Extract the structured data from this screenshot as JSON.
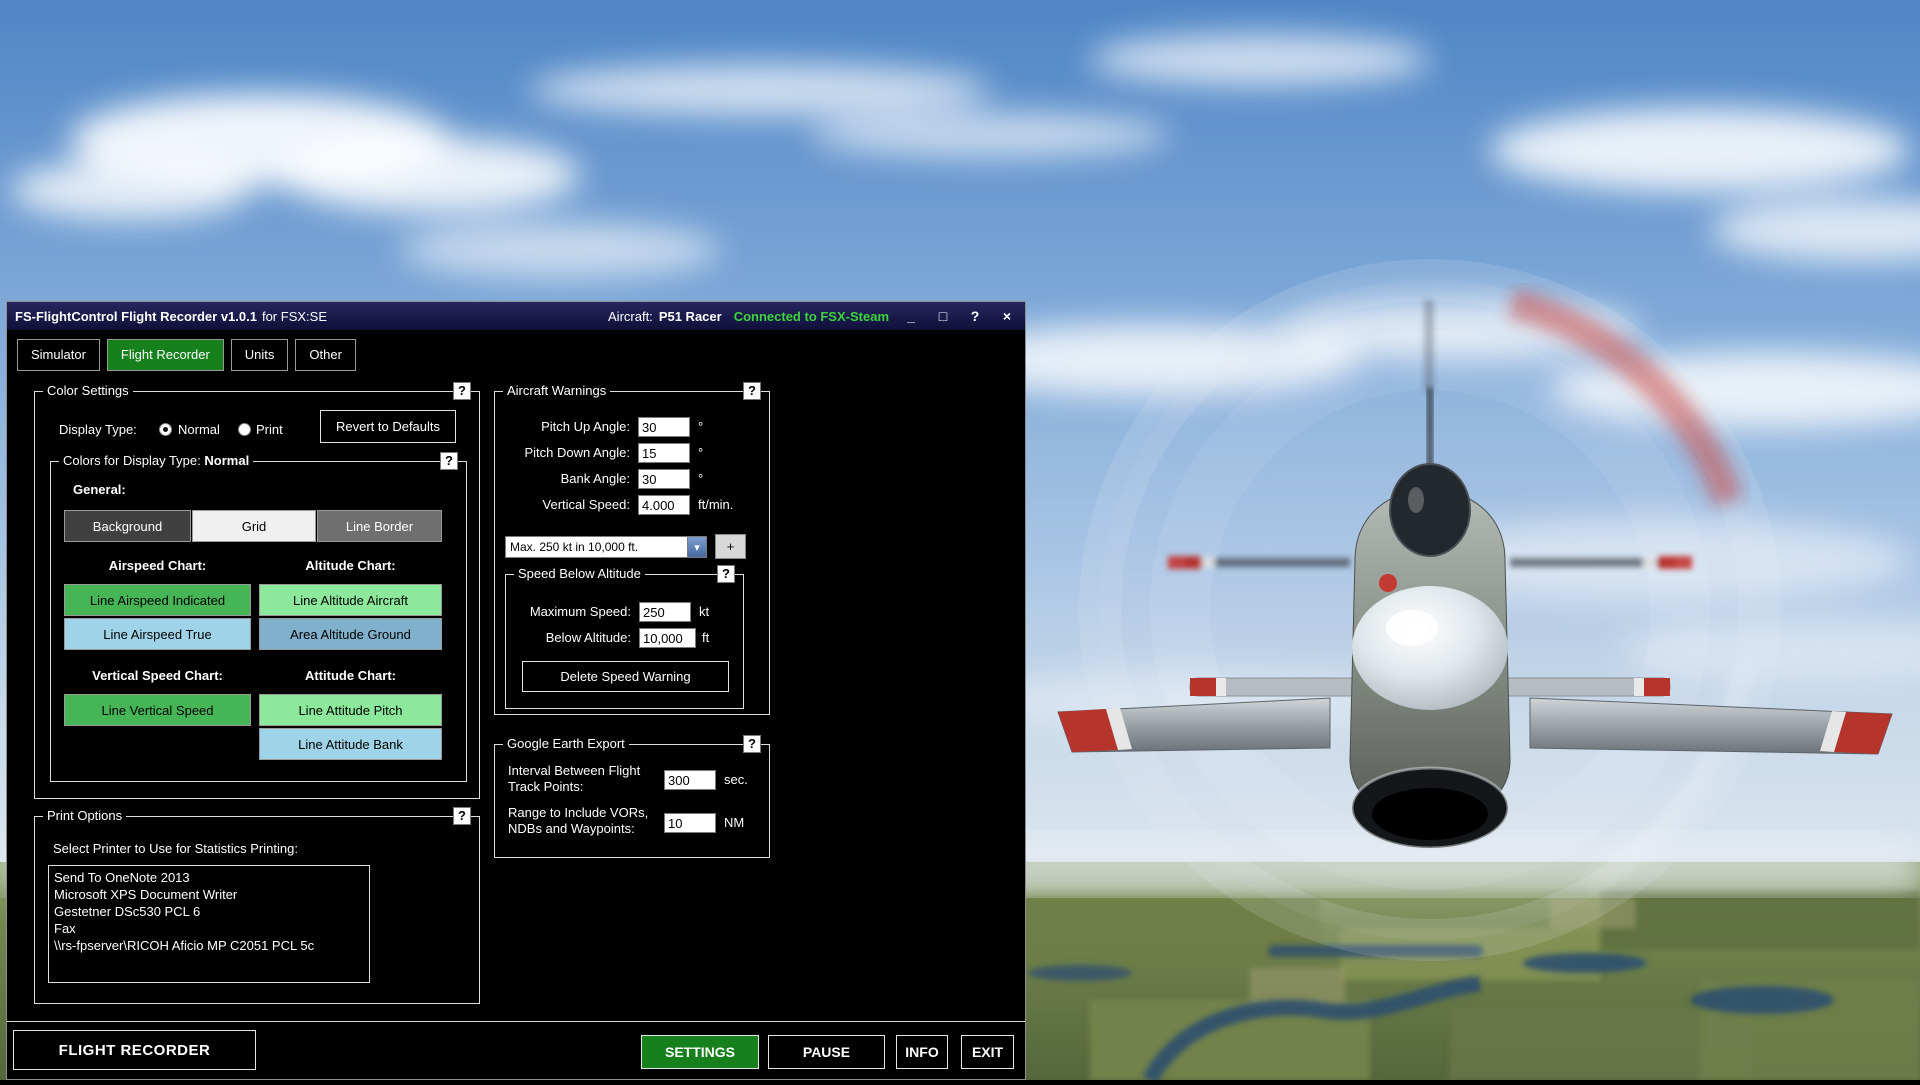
{
  "window": {
    "title": "FS-FlightControl Flight Recorder v1.0.1",
    "title_suffix": "for FSX:SE",
    "aircraft_label": "Aircraft:",
    "aircraft_value": "P51 Racer",
    "connection_status": "Connected to FSX-Steam",
    "minimize": "_",
    "maximize": "□",
    "help": "?",
    "close": "×"
  },
  "tabs": {
    "simulator": "Simulator",
    "flight_recorder": "Flight Recorder",
    "units": "Units",
    "other": "Other"
  },
  "color_settings": {
    "title": "Color Settings",
    "help": "?",
    "display_type_label": "Display Type:",
    "radio_normal": "Normal",
    "radio_print": "Print",
    "revert_button": "Revert to Defaults",
    "colors_group_title": "Colors for Display Type:",
    "colors_group_value": "Normal",
    "colors_help": "?",
    "general_label": "General:",
    "btn_background": "Background",
    "btn_grid": "Grid",
    "btn_line_border": "Line Border",
    "airspeed_chart_label": "Airspeed Chart:",
    "altitude_chart_label": "Altitude Chart:",
    "btn_line_airspeed_indicated": "Line Airspeed Indicated",
    "btn_line_airspeed_true": "Line Airspeed True",
    "btn_line_altitude_aircraft": "Line Altitude Aircraft",
    "btn_area_altitude_ground": "Area Altitude Ground",
    "vertical_speed_chart_label": "Vertical Speed Chart:",
    "attitude_chart_label": "Attitude Chart:",
    "btn_line_vertical_speed": "Line Vertical Speed",
    "btn_line_attitude_pitch": "Line Attitude Pitch",
    "btn_line_attitude_bank": "Line Attitude Bank"
  },
  "print_options": {
    "title": "Print Options",
    "help": "?",
    "select_label": "Select Printer to Use for Statistics Printing:",
    "printers": [
      "Send To OneNote 2013",
      "Microsoft XPS Document Writer",
      "Gestetner DSc530 PCL 6",
      "Fax",
      "\\\\rs-fpserver\\RICOH Aficio MP C2051 PCL 5c"
    ]
  },
  "aircraft_warnings": {
    "title": "Aircraft Warnings",
    "help": "?",
    "pitch_up_label": "Pitch Up Angle:",
    "pitch_up_value": "30",
    "pitch_up_unit": "°",
    "pitch_down_label": "Pitch Down Angle:",
    "pitch_down_value": "15",
    "pitch_down_unit": "°",
    "bank_label": "Bank Angle:",
    "bank_value": "30",
    "bank_unit": "°",
    "vs_label": "Vertical Speed:",
    "vs_value": "4.000",
    "vs_unit": "ft/min.",
    "warning_select_value": "Max. 250 kt in 10,000 ft.",
    "add_button": "+",
    "speed_below_altitude": {
      "title": "Speed Below Altitude",
      "help": "?",
      "max_speed_label": "Maximum Speed:",
      "max_speed_value": "250",
      "max_speed_unit": "kt",
      "below_alt_label": "Below Altitude:",
      "below_alt_value": "10,000",
      "below_alt_unit": "ft",
      "delete_button": "Delete Speed Warning"
    }
  },
  "google_earth": {
    "title": "Google Earth Export",
    "help": "?",
    "interval_label": "Interval Between Flight Track Points:",
    "interval_value": "300",
    "interval_unit": "sec.",
    "range_label": "Range to Include VORs, NDBs and Waypoints:",
    "range_value": "10",
    "range_unit": "NM"
  },
  "footer": {
    "flight_recorder_button": "FLIGHT RECORDER",
    "settings_button": "SETTINGS",
    "pause_button": "PAUSE",
    "info_button": "INFO",
    "exit_button": "EXIT"
  },
  "icons": {
    "dropdown_arrow": "▾"
  },
  "palette": {
    "active_tab": "#16801c",
    "settings_btn": "#16801c",
    "connected_text": "#3dd33d",
    "background_btn": "#404040",
    "grid_btn": "#f0f0f0",
    "line_border_btn": "#6f6f6f",
    "line_airspeed_indicated": "#46b556",
    "line_airspeed_true": "#9fd4e8",
    "line_altitude_aircraft": "#8ce89a",
    "area_altitude_ground": "#7fb0cc",
    "line_vertical_speed": "#46b556",
    "line_attitude_pitch": "#8ce89a",
    "line_attitude_bank": "#9fd4e8"
  }
}
